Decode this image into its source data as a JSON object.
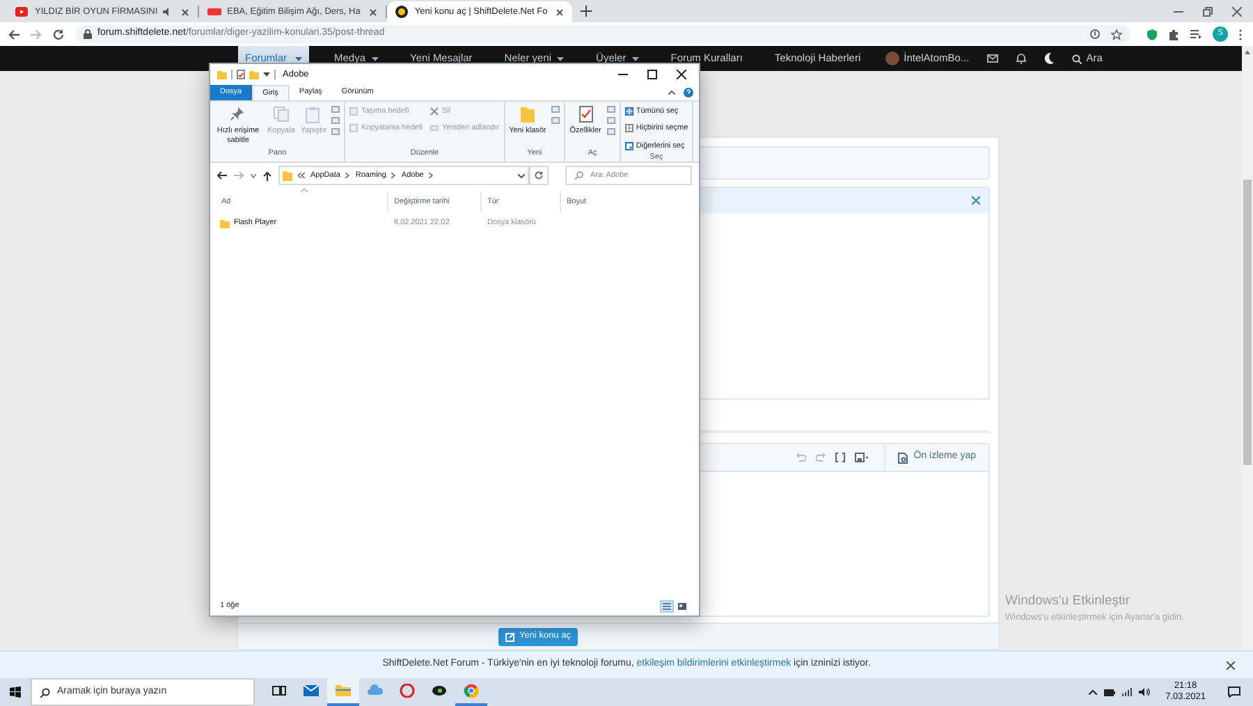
{
  "browser": {
    "tabs": [
      {
        "title": "YILDIZ BİR OYUN FİRMASINI",
        "kind": "video",
        "audio": true,
        "selected": false
      },
      {
        "title": "EBA, Eğitim Bilişim Ağı, Ders, Ha",
        "kind": "eba",
        "audio": false,
        "selected": false
      },
      {
        "title": "Yeni konu aç | ShiftDelete.Net Fo",
        "kind": "forum",
        "audio": false,
        "selected": true
      }
    ],
    "address": {
      "host": "forum.shiftdelete.net",
      "path": "/forumlar/diger-yazilim-konulari.35/post-thread"
    },
    "profile_initial": "S"
  },
  "forum_nav": {
    "items": [
      {
        "label": "Forumlar",
        "selected": true,
        "dropdown": true
      },
      {
        "label": "Medya",
        "selected": false,
        "dropdown": true
      },
      {
        "label": "Yeni Mesajlar",
        "selected": false,
        "dropdown": false
      },
      {
        "label": "Neler yeni",
        "selected": false,
        "dropdown": true
      },
      {
        "label": "Üyeler",
        "selected": false,
        "dropdown": true
      },
      {
        "label": "Forum Kuralları",
        "selected": false,
        "dropdown": false
      },
      {
        "label": "Teknoloji Haberleri",
        "selected": false,
        "dropdown": false
      }
    ],
    "user": "İntelAtomBo...",
    "search": "Ara"
  },
  "explorer": {
    "title": "Adobe",
    "ribbon_tabs": [
      {
        "label": "Dosya",
        "kind": "file",
        "selected": false
      },
      {
        "label": "Giriş",
        "kind": "tab",
        "selected": true
      },
      {
        "label": "Paylaş",
        "kind": "tab",
        "selected": false
      },
      {
        "label": "Görünüm",
        "kind": "tab",
        "selected": false
      }
    ],
    "groups": [
      {
        "label": "Pano",
        "items": [
          {
            "label": "Hızlı erişime sabitle",
            "kind": "large",
            "disabled": false
          },
          {
            "label": "Kopyala",
            "kind": "large",
            "disabled": true
          },
          {
            "label": "Yapıştır",
            "kind": "large",
            "disabled": true
          }
        ]
      },
      {
        "label": "Düzenle",
        "items": [
          {
            "label": "Taşıma hedefi",
            "kind": "small",
            "disabled": true
          },
          {
            "label": "Kopyalama hedefi",
            "kind": "small",
            "disabled": true
          },
          {
            "label": "Sil",
            "kind": "small",
            "disabled": true
          },
          {
            "label": "Yeniden adlandır",
            "kind": "small",
            "disabled": true
          }
        ]
      },
      {
        "label": "Yeni",
        "items": [
          {
            "label": "Yeni klasör",
            "kind": "large",
            "disabled": false
          }
        ]
      },
      {
        "label": "Aç",
        "items": [
          {
            "label": "Özellikler",
            "kind": "large",
            "disabled": false
          }
        ]
      },
      {
        "label": "Seç",
        "items": [
          {
            "label": "Tümünü seç",
            "kind": "small",
            "disabled": false
          },
          {
            "label": "Hiçbirini seçme",
            "kind": "small",
            "disabled": false
          },
          {
            "label": "Diğerlerini seç",
            "kind": "small",
            "disabled": false
          }
        ]
      }
    ],
    "path": [
      "AppData",
      "Roaming",
      "Adobe"
    ],
    "search_placeholder": "Ara: Adobe",
    "columns": [
      "Ad",
      "Değiştirme tarihi",
      "Tür",
      "Boyut"
    ],
    "rows": [
      {
        "name": "Flash Player",
        "modified": "8.02.2021 22:02",
        "type": "Dosya klasörü"
      }
    ],
    "status": "1 öğe",
    "view_modes": [
      {
        "kind": "details",
        "selected": true
      },
      {
        "kind": "tiles",
        "selected": false
      }
    ]
  },
  "editor": {
    "preview_button": "Ön izleme yap"
  },
  "submit_button": "Yeni konu aç",
  "notice": {
    "before": "ShiftDelete.Net Forum - Türkiye'nin en iyi teknoloji forumu, ",
    "link": "etkileşim bildirimlerini etkinleştirmek",
    "after": " için izninizi istiyor."
  },
  "activation": {
    "title": "Windows'u Etkinleştir",
    "subtitle": "Windows'u etkinleştirmek için Ayarlar'a gidin."
  },
  "taskbar": {
    "search_placeholder": "Aramak için buraya yazın",
    "apps": [
      {
        "kind": "task-view",
        "running": false,
        "active": false
      },
      {
        "kind": "mail",
        "running": false,
        "active": false
      },
      {
        "kind": "explorer",
        "running": true,
        "active": true
      },
      {
        "kind": "weather",
        "running": false,
        "active": false
      },
      {
        "kind": "opera",
        "running": false,
        "active": false
      },
      {
        "kind": "game",
        "running": false,
        "active": false
      },
      {
        "kind": "chrome",
        "running": true,
        "active": false
      }
    ],
    "time": "21:18",
    "date": "7.03.2021"
  }
}
